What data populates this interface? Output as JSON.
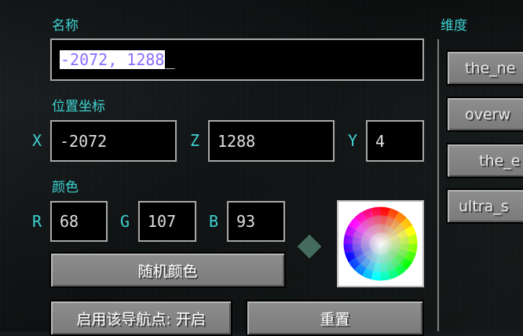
{
  "labels": {
    "name": "名称",
    "position": "位置坐标",
    "color": "颜色",
    "dimension": "维度"
  },
  "name_field": {
    "value": "-2072, 1288",
    "cursor": "_"
  },
  "coords": {
    "x_label": "X",
    "x_value": "-2072",
    "z_label": "Z",
    "z_value": "1288",
    "y_label": "Y",
    "y_value": "4"
  },
  "rgb": {
    "r_label": "R",
    "r_value": "68",
    "g_label": "G",
    "g_value": "107",
    "b_label": "B",
    "b_value": "93",
    "swatch_color": "#446b5d"
  },
  "buttons": {
    "random_color": "随机颜色",
    "enable_waypoint": "启用该导航点: 开启",
    "reset": "重置"
  },
  "dimensions": [
    "the_ne",
    "overw",
    "the_e",
    "ultra_s"
  ]
}
